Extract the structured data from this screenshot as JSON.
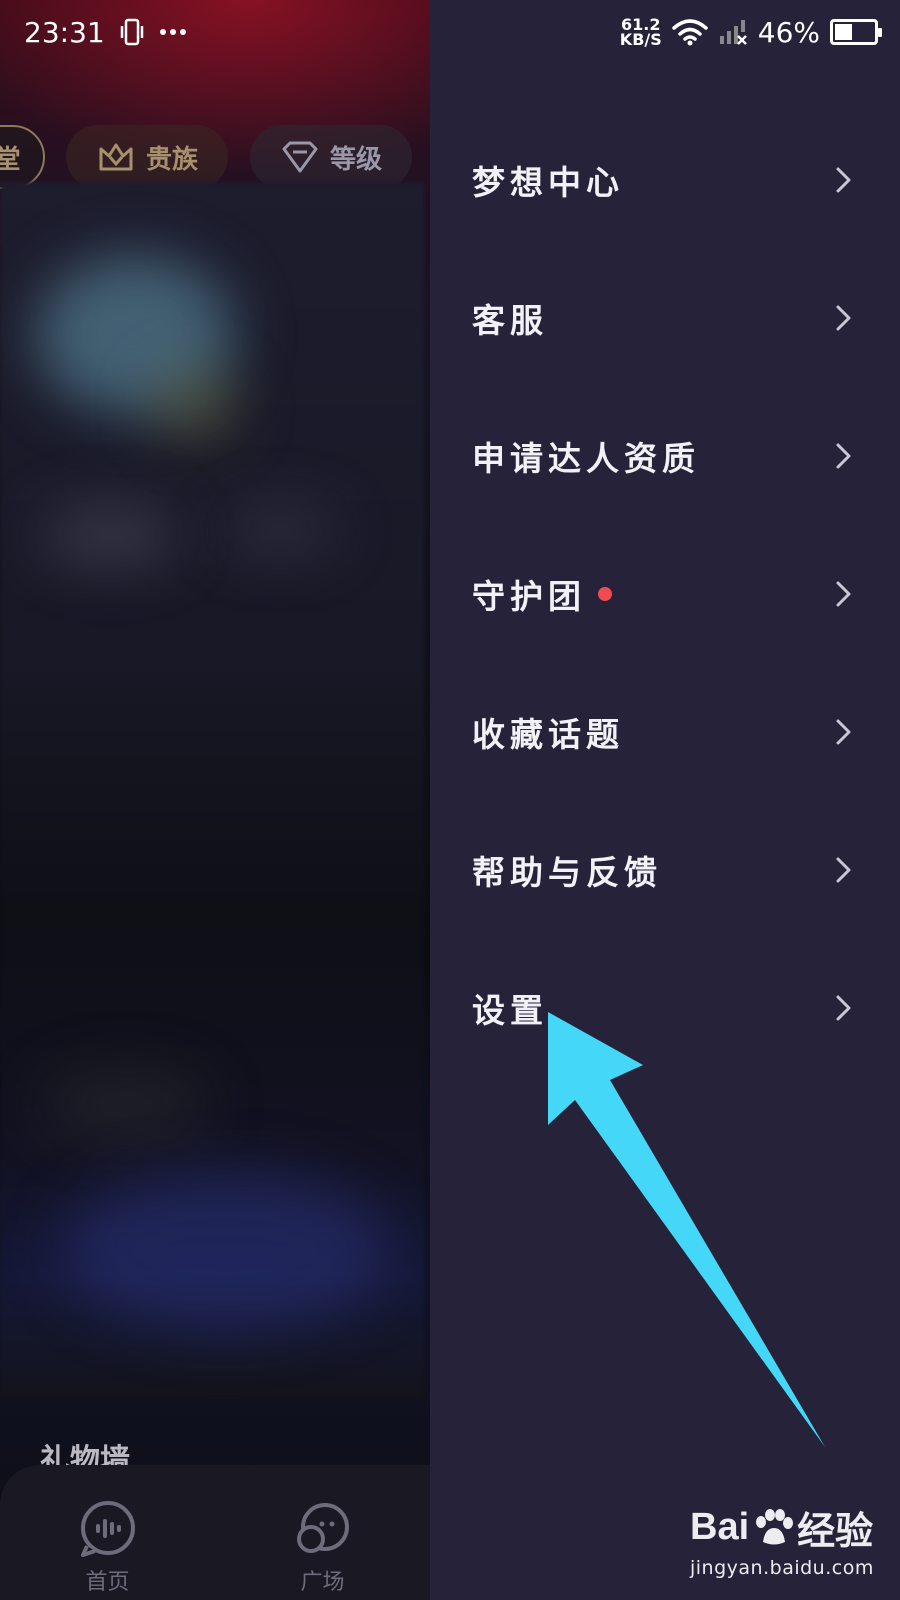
{
  "status_bar": {
    "time": "23:31",
    "net_speed_value": "61.2",
    "net_speed_unit": "KB/S",
    "battery_percent": "46%",
    "battery_level": 0.46
  },
  "background_app": {
    "pills": [
      {
        "label": "堂",
        "icon": "circle-badge-icon"
      },
      {
        "label": "贵族",
        "icon": "crown-icon"
      },
      {
        "label": "等级",
        "icon": "diamond-icon"
      }
    ],
    "section_title": "礼物墙",
    "tabs": [
      {
        "label": "首页",
        "icon": "voice-wave-icon"
      },
      {
        "label": "广场",
        "icon": "planet-face-icon"
      }
    ]
  },
  "drawer": {
    "items": [
      {
        "label": "梦想中心",
        "has_dot": false
      },
      {
        "label": "客服",
        "has_dot": false
      },
      {
        "label": "申请达人资质",
        "has_dot": false
      },
      {
        "label": "守护团",
        "has_dot": true
      },
      {
        "label": "收藏话题",
        "has_dot": false
      },
      {
        "label": "帮助与反馈",
        "has_dot": false
      },
      {
        "label": "设置",
        "has_dot": false
      }
    ],
    "background_color": "#25223a",
    "dot_color": "#f04b55"
  },
  "annotation": {
    "arrow_color": "#44d7f7"
  },
  "watermark": {
    "brand_a": "Bai",
    "brand_b": "经验",
    "url": "jingyan.baidu.com"
  }
}
